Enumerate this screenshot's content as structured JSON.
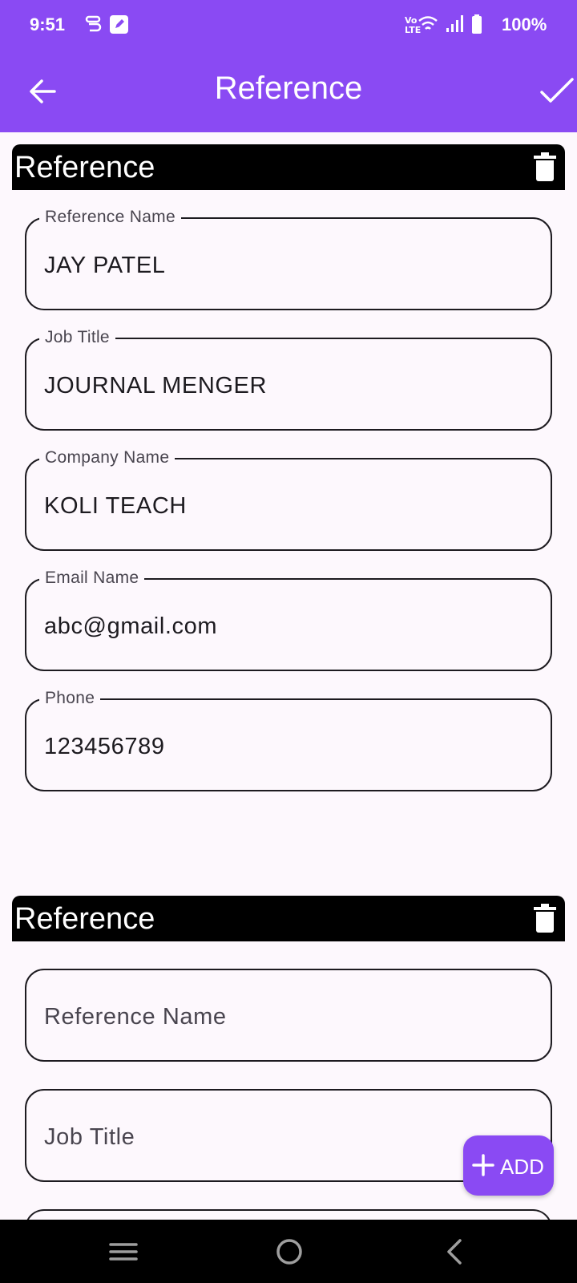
{
  "status_bar": {
    "time": "9:51",
    "battery": "100%",
    "network": "VoLTE",
    "icons": [
      "sim-icon",
      "notes-icon",
      "volte-icon",
      "wifi-icon",
      "signal-icon",
      "battery-icon"
    ]
  },
  "app_bar": {
    "title": "Reference",
    "background": "#8a4af3",
    "icons": [
      "back-arrow-icon",
      "check-icon"
    ]
  },
  "references": [
    {
      "title": "Reference",
      "fields": [
        {
          "label": "Reference Name",
          "value": "JAY PATEL"
        },
        {
          "label": "Job Title",
          "value": "JOURNAL MENGER"
        },
        {
          "label": "Company Name",
          "value": "KOLI TEACH"
        },
        {
          "label": "Email Name",
          "value": "abc@gmail.com"
        },
        {
          "label": "Phone",
          "value": "123456789"
        }
      ]
    },
    {
      "title": "Reference",
      "fields": [
        {
          "placeholder": "Reference Name",
          "value": ""
        },
        {
          "placeholder": "Job Title",
          "value": ""
        }
      ]
    }
  ],
  "fab": {
    "label": "ADD",
    "icon": "plus-icon"
  },
  "nav_bar": {
    "icons": [
      "recents-icon",
      "home-icon",
      "back-icon"
    ]
  }
}
